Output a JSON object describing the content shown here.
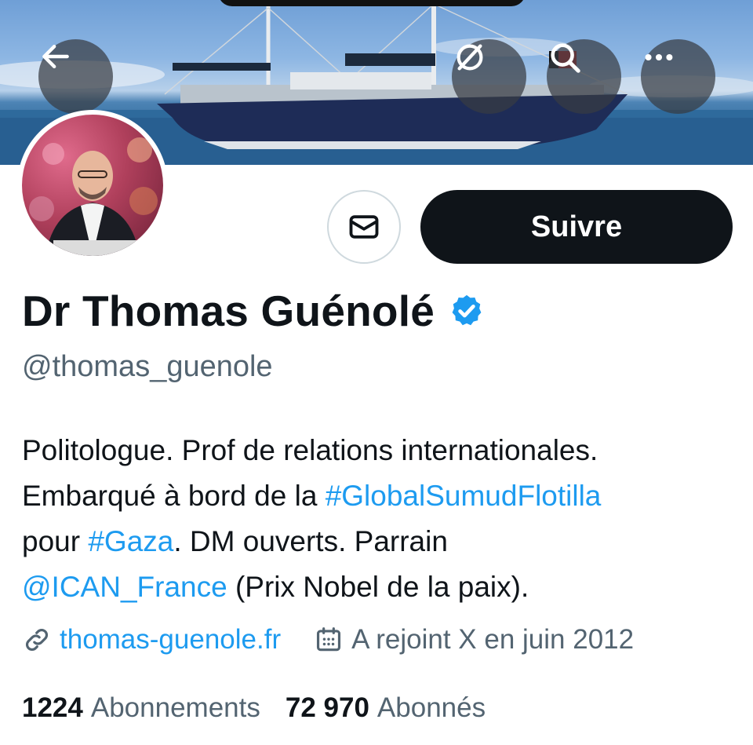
{
  "header": {
    "back_icon": "arrow-left-icon",
    "hide_icon": "eye-slash-icon",
    "search_icon": "search-icon",
    "more_icon": "more-horizontal-icon"
  },
  "actions": {
    "message_icon": "envelope-icon",
    "follow_label": "Suivre"
  },
  "profile": {
    "name": "Dr Thomas Guénolé",
    "verified_icon": "verified-badge-icon",
    "verified_color": "#1d9bf0",
    "handle": "@thomas_guenole",
    "bio": {
      "line1": "Politologue. Prof de relations internationales.",
      "line2_pre": "Embarqué à bord de la ",
      "line2_link": "#GlobalSumudFlotilla",
      "line3_pre": "pour ",
      "line3_link": "#Gaza",
      "line3_post": ". DM ouverts. Parrain",
      "line4_link": "@ICAN_France",
      "line4_post": " (Prix Nobel de la paix)."
    },
    "website": "thomas-guenole.fr",
    "joined": "A rejoint X en juin 2012",
    "following_count": "1224",
    "following_label": "Abonnements",
    "followers_count": "72 970",
    "followers_label": "Abonnés"
  },
  "colors": {
    "link": "#1d9bf0",
    "secondary_text": "#536471",
    "primary_text": "#0f1419"
  }
}
